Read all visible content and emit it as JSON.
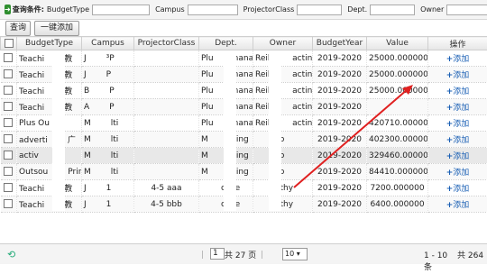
{
  "filter": {
    "label": "查询条件:",
    "budget_type": "BudgetType",
    "campus": "Campus",
    "projector_class": "ProjectorClass",
    "dept": "Dept.",
    "owner": "Owner"
  },
  "buttons": {
    "query": "查询",
    "bulk_add": "一键添加"
  },
  "columns": [
    "BudgetType",
    "Campus",
    "ProjectorClass",
    "Dept.",
    "Owner",
    "BudgetYear",
    "Value",
    "操作"
  ],
  "rows": [
    {
      "type": "Teachi",
      "type2": "教",
      "campus": "J",
      "campus2": "³P",
      "pclass": "",
      "dept": "Plu",
      "dept2": "nanager",
      "owner": "Reik",
      "owner2": "acting)",
      "year": "2019-2020",
      "value": "25000.000000",
      "action": "添加"
    },
    {
      "type": "Teachi",
      "type2": "教",
      "campus": "J",
      "campus2": "P",
      "pclass": "",
      "dept": "Plu",
      "dept2": "nanager",
      "owner": "Reik",
      "owner2": "acting)",
      "year": "2019-2020",
      "value": "25000.000000",
      "action": "添加"
    },
    {
      "type": "Teachi",
      "type2": "教",
      "campus": "B",
      "campus2": "P",
      "pclass": "",
      "dept": "Plu",
      "dept2": "nanager",
      "owner": "Reik",
      "owner2": "acting)",
      "year": "2019-2020",
      "value": "25000.000000",
      "action": "添加"
    },
    {
      "type": "Teachi",
      "type2": "教",
      "campus": "A",
      "campus2": "P",
      "pclass": "",
      "dept": "Plu",
      "dept2": "nanager",
      "owner": "Reik",
      "owner2": "acting)",
      "year": "2019-2020",
      "value": "",
      "action": "添加"
    },
    {
      "type": "Plus Ou",
      "type2": "",
      "campus": "M",
      "campus2": "lti",
      "pclass": "",
      "dept": "Plu",
      "dept2": "nanager",
      "owner": "Reik",
      "owner2": "acting)",
      "year": "2019-2020",
      "value": "420710.000000",
      "action": "添加"
    },
    {
      "type": "adverti",
      "type2": "广",
      "campus": "M",
      "campus2": "lti",
      "pclass": "",
      "dept": "M",
      "dept2": "eting",
      "owner": "",
      "owner2": "ko",
      "year": "2019-2020",
      "value": "402300.000000",
      "action": "添加"
    },
    {
      "type": "activ",
      "type2": "",
      "campus": "M",
      "campus2": "lti",
      "pclass": "",
      "dept": "M",
      "dept2": "eting",
      "owner": "",
      "owner2": "ko",
      "year": "2019-2020",
      "value": "329460.000000",
      "action": "添加"
    },
    {
      "type": "Outsou",
      "type2": "Prin",
      "campus": "M",
      "campus2": "lti",
      "pclass": "",
      "dept": "M",
      "dept2": "eting",
      "owner": "",
      "owner2": "ko",
      "year": "2019-2020",
      "value": "84410.000000",
      "action": "添加"
    },
    {
      "type": "Teachi",
      "type2": "教",
      "campus": "J",
      "campus2": "1",
      "pclass": "4-5 aaa",
      "dept": "",
      "dept2": "ciple",
      "owner": "",
      "owner2": "othy",
      "year": "2019-2020",
      "value": "7200.000000",
      "action": "添加"
    },
    {
      "type": "Teachi",
      "type2": "教",
      "campus": "J",
      "campus2": "1",
      "pclass": "4-5 bbb",
      "dept": "",
      "dept2": "ciple",
      "owner": "",
      "owner2": "othy",
      "year": "2019-2020",
      "value": "6400.000000",
      "action": "添加"
    }
  ],
  "pager": {
    "page": "1",
    "of_pages": "共 27 页",
    "page_size": "10",
    "range": "1 - 10",
    "total": "共 264 条"
  },
  "colors": {
    "accent_link": "#1a5fb4",
    "arrow": "#e02020"
  },
  "icons": {
    "filter": "search-green-icon",
    "refresh": "refresh-icon",
    "select": "chevron-down-icon"
  }
}
